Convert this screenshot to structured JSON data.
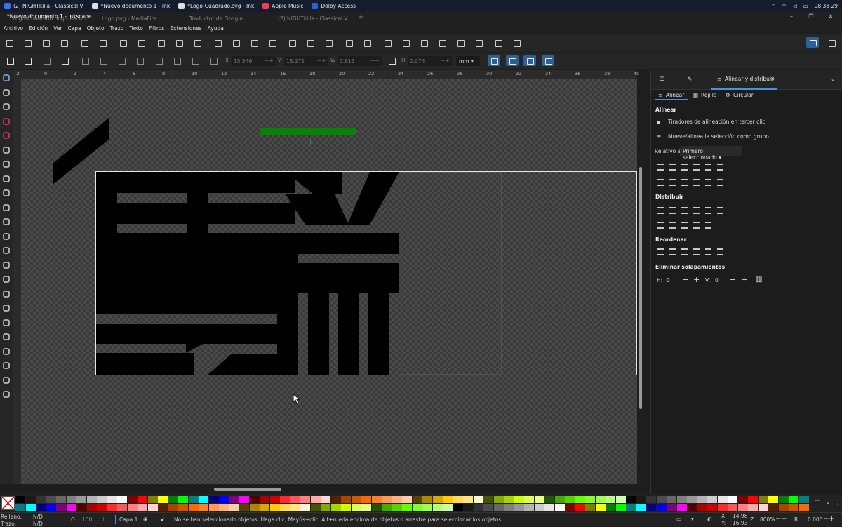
{
  "taskbar": {
    "tasks": [
      {
        "label": "(2) NIGHTkilla - Classical V",
        "color": "#e33"
      },
      {
        "label": "*Nuevo documento 1 - Ink",
        "color": "#ddd"
      },
      {
        "label": "*Logo-Cuadrado.svg - Ink",
        "color": "#ddd"
      },
      {
        "label": "Apple Music",
        "color": "#fa3a55"
      },
      {
        "label": "Dolby Access",
        "color": "#2b63d8"
      }
    ],
    "time": "08 38 29"
  },
  "window": {
    "title": "*Nuevo documento 1 - Inkscape",
    "background_tabs": [
      "Logo-Cuadrado.png - Recor",
      "Logo.png - MediaFire",
      "Traductor de Google",
      "(2) NIGHTkilla - Classical V"
    ]
  },
  "menu": [
    "Archivo",
    "Edición",
    "Ver",
    "Capa",
    "Objeto",
    "Trazo",
    "Texto",
    "Filtros",
    "Extensiones",
    "Ayuda"
  ],
  "controls": {
    "x_label": "X:",
    "x_value": "15.346",
    "y_label": "Y:",
    "y_value": "15.271",
    "w_label": "W:",
    "w_value": "0.613",
    "h_label": "H:",
    "h_value": "0.074",
    "unit": "mm"
  },
  "ruler": {
    "top_labels": [
      "-2",
      "0",
      "2",
      "4",
      "6",
      "8",
      "10",
      "12",
      "14",
      "16",
      "18",
      "20",
      "22",
      "24",
      "26",
      "28",
      "30",
      "32",
      "34",
      "36",
      "38",
      "40"
    ]
  },
  "panel": {
    "title": "Alinear y distribuir",
    "subtabs": [
      "Alinear",
      "Rejilla",
      "Circular"
    ],
    "align_heading": "Alinear",
    "opt1": "Tiradores de alineación en tercer clic",
    "opt2": "Mueve/alinea la selección como grupo",
    "relative_label": "Relativo a:",
    "relative_value": "Primero seleccionado",
    "distribute_heading": "Distribuir",
    "reorder_heading": "Reordenar",
    "overlap_heading": "Eliminar solapamientos",
    "h_label": "H:",
    "h_value": "0",
    "v_label": "V:",
    "v_value": "0"
  },
  "palette_colors": [
    "#000000",
    "#1a1a1a",
    "#333333",
    "#4d4d4d",
    "#666666",
    "#808080",
    "#999999",
    "#b3b3b3",
    "#cccccc",
    "#e6e6e6",
    "#ffffff",
    "#800000",
    "#ff0000",
    "#808000",
    "#ffff00",
    "#008000",
    "#00ff00",
    "#008080",
    "#00ffff",
    "#000080",
    "#0000ff",
    "#800080",
    "#ff00ff",
    "#550000",
    "#aa0000",
    "#d40000",
    "#ff2a2a",
    "#ff5555",
    "#ff8080",
    "#ffaaaa",
    "#ffd5d5",
    "#552200",
    "#aa4400",
    "#d45500",
    "#ff6600",
    "#ff7f2a",
    "#ff9955",
    "#ffb380",
    "#ffccaa",
    "#554400",
    "#aa8800",
    "#d4aa00",
    "#ffcc00",
    "#ffdd55",
    "#ffe680",
    "#fff6d5",
    "#445500",
    "#88aa00",
    "#aad400",
    "#ccff00",
    "#ddff55",
    "#e5ff80",
    "#225500",
    "#44aa00",
    "#55d400",
    "#66ff00",
    "#7fff2a",
    "#99ff55",
    "#b3ff80",
    "#ccffaa"
  ],
  "status": {
    "fill_label": "Relleno:",
    "fill_value": "N/D",
    "stroke_label": "Trazo:",
    "stroke_value": "N/D",
    "opacity_label": "O:",
    "opacity_value": "100",
    "layer": "Capa 1",
    "message": "No se han seleccionado objetos. Haga clic, Mayús+clic, Alt+rueda encima de objetos o arrastre para seleccionar los objetos.",
    "x_label": "X:",
    "x_value": "14.98",
    "y_label": "Y:",
    "y_value": "16.93",
    "zoom_label": "Z:",
    "zoom_value": "800%",
    "rot_label": "R:",
    "rot_value": "0.00°"
  }
}
